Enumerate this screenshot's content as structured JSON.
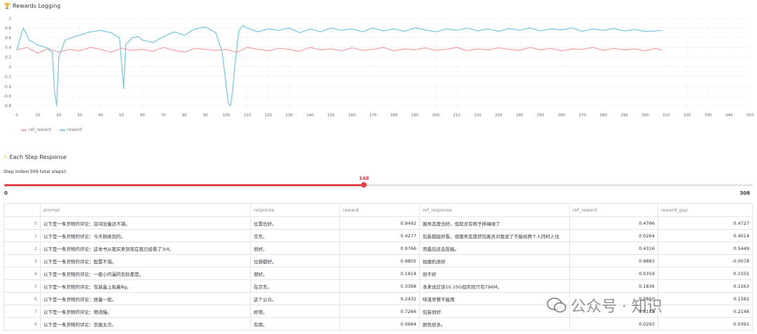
{
  "rewards_section": {
    "icon": "trophy-icon",
    "title": "Rewards Logging"
  },
  "steps_section": {
    "icon": "lightning-icon",
    "title": "Each Step Response"
  },
  "slider": {
    "label": "Step Index(309 total steps):",
    "min": "0",
    "max": "308",
    "value": "148",
    "value_num": 148,
    "max_num": 308
  },
  "table": {
    "columns": [
      "",
      "prompt",
      "response",
      "reward",
      "ref_response",
      "ref_reward",
      "reward_gap"
    ],
    "rows": [
      [
        "0",
        "以下是一条货物的评论：房间设备还不错。",
        "位置也好。",
        "0.9492",
        "服务态度也好。但就没有转子摔绳球了",
        "0.4766",
        "0.4727"
      ],
      [
        "1",
        "以下是一条货物的评论：今天刚收到的。",
        "京东。",
        "0.4277",
        "包装都挺好看。但服务态度挤馅客员对我说了不能给两个人同时入住",
        "0.0264",
        "0.4014"
      ],
      [
        "2",
        "以下是一条货物的评论：这本书从我买来到现在我已经看了3/4。",
        "很好。",
        "0.9766",
        "而最后还会投稿。",
        "0.4316",
        "0.5449"
      ],
      [
        "3",
        "以下是一条货物的评论：配置不错。",
        "位施都好。",
        "0.9805",
        "拍摄机很好",
        "0.9883",
        "-0.0078"
      ],
      [
        "4",
        "以下是一条货物的评论：一瓶小的漏的到处都是。",
        "倒好。",
        "0.1914",
        "很不好",
        "0.0359",
        "0.1555"
      ],
      [
        "5",
        "以下是一条货物的评论：包装盒上贴着8g。",
        "在京东。",
        "0.3398",
        "本来说应该10.25G但实际只有796M。",
        "0.1836",
        "0.1563"
      ],
      [
        "6",
        "以下是一条货物的评论：质量一般。",
        "这个公众。",
        "0.2432",
        "味道早餐不能用",
        "0.0850",
        "0.1582"
      ],
      [
        "7",
        "以下是一条货物的评论：物流慢。",
        "好用。",
        "0.7266",
        "包装很好",
        "0.5118",
        "0.2148"
      ],
      [
        "8",
        "以下是一条货物的评论：衣服太次。",
        "有用。",
        "0.0684",
        "颜色很多。",
        "0.0293",
        "0.0391"
      ]
    ]
  },
  "watermark": {
    "text": "公众号 · 知识",
    "icon": "wechat-icon"
  },
  "chart_data": {
    "type": "line",
    "title": "",
    "xlabel": "",
    "ylabel": "",
    "xlim": [
      0,
      350
    ],
    "ylim": [
      -0.9,
      1.0
    ],
    "xticks": [
      0,
      10,
      20,
      30,
      40,
      50,
      60,
      70,
      80,
      90,
      100,
      110,
      120,
      130,
      140,
      150,
      160,
      170,
      180,
      190,
      200,
      210,
      220,
      230,
      240,
      250,
      260,
      270,
      280,
      290,
      300,
      310,
      320,
      330,
      340,
      350
    ],
    "yticks": [
      1,
      0.8,
      0.6,
      0.4,
      0.2,
      0,
      -0.2,
      -0.4,
      -0.6,
      -0.8
    ],
    "ytick_labels": [
      "1",
      "0.8",
      "0.6",
      "0.4",
      "0.2",
      "0",
      "-0.2",
      "-0.4",
      "-0.6",
      "-0.8"
    ],
    "grid": true,
    "legend_position": "bottom-left",
    "series": [
      {
        "name": "ref_reward",
        "color": "#f4a6a6",
        "x": [
          0,
          5,
          10,
          15,
          20,
          25,
          30,
          35,
          40,
          45,
          50,
          55,
          60,
          65,
          70,
          75,
          80,
          85,
          90,
          95,
          100,
          105,
          110,
          115,
          120,
          125,
          130,
          135,
          140,
          145,
          150,
          155,
          160,
          165,
          170,
          175,
          180,
          185,
          190,
          195,
          200,
          205,
          210,
          215,
          220,
          225,
          230,
          235,
          240,
          245,
          250,
          255,
          260,
          265,
          270,
          275,
          280,
          285,
          290,
          295,
          300,
          305,
          308
        ],
        "y": [
          0.35,
          0.4,
          0.28,
          0.38,
          0.3,
          0.36,
          0.33,
          0.4,
          0.36,
          0.3,
          0.38,
          0.34,
          0.36,
          0.32,
          0.4,
          0.34,
          0.3,
          0.38,
          0.36,
          0.34,
          0.36,
          0.3,
          0.4,
          0.36,
          0.33,
          0.38,
          0.36,
          0.32,
          0.4,
          0.35,
          0.37,
          0.33,
          0.39,
          0.34,
          0.36,
          0.4,
          0.33,
          0.37,
          0.35,
          0.39,
          0.34,
          0.36,
          0.4,
          0.33,
          0.37,
          0.35,
          0.39,
          0.36,
          0.34,
          0.4,
          0.35,
          0.38,
          0.33,
          0.37,
          0.36,
          0.4,
          0.34,
          0.38,
          0.35,
          0.37,
          0.33,
          0.38,
          0.34
        ]
      },
      {
        "name": "reward",
        "color": "#7ec8e3",
        "x": [
          0,
          3,
          6,
          10,
          14,
          17,
          18,
          19,
          20,
          23,
          26,
          30,
          35,
          40,
          45,
          49,
          50,
          51,
          52,
          53,
          55,
          58,
          60,
          65,
          70,
          75,
          80,
          85,
          90,
          95,
          98,
          100,
          101,
          102,
          103,
          104,
          106,
          108,
          110,
          115,
          120,
          125,
          130,
          135,
          140,
          145,
          150,
          155,
          160,
          165,
          170,
          175,
          180,
          185,
          190,
          195,
          200,
          205,
          210,
          215,
          220,
          225,
          230,
          235,
          240,
          245,
          250,
          255,
          260,
          265,
          270,
          275,
          280,
          285,
          290,
          295,
          300,
          305,
          308
        ],
        "y": [
          0.35,
          0.8,
          0.55,
          0.45,
          0.4,
          0.3,
          -0.5,
          -0.8,
          0.2,
          0.55,
          0.6,
          0.65,
          0.72,
          0.75,
          0.7,
          0.6,
          0.1,
          -0.45,
          0.45,
          0.5,
          0.6,
          0.62,
          0.55,
          0.5,
          0.62,
          0.72,
          0.65,
          0.78,
          0.82,
          0.7,
          0.3,
          -0.4,
          -0.75,
          -0.8,
          -0.5,
          0.0,
          0.75,
          0.85,
          0.8,
          0.72,
          0.78,
          0.75,
          0.8,
          0.7,
          0.78,
          0.72,
          0.8,
          0.75,
          0.78,
          0.72,
          0.8,
          0.74,
          0.78,
          0.73,
          0.8,
          0.76,
          0.72,
          0.78,
          0.75,
          0.8,
          0.74,
          0.78,
          0.73,
          0.79,
          0.75,
          0.8,
          0.74,
          0.78,
          0.76,
          0.8,
          0.73,
          0.78,
          0.75,
          0.79,
          0.74,
          0.77,
          0.73,
          0.74,
          0.75
        ]
      }
    ]
  }
}
